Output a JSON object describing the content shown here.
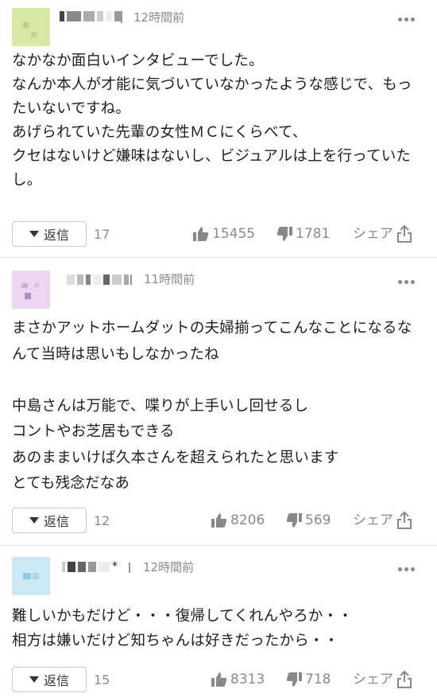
{
  "comments": [
    {
      "username": "",
      "time": "12時間前",
      "text": "なかなか面白いインタビューでした。\nなんか本人が才能に気づいていなかったような感じで、もったいないですね。\nあげられていた先輩の女性ＭＣにくらべて、\nクセはないけど嫌味はないし、ビジュアルは上を行っていたし。",
      "reply_label": "返信",
      "reply_count": "17",
      "likes": "15455",
      "dislikes": "1781",
      "share_label": "シェア",
      "avatar_color": "#d7e8a8"
    },
    {
      "username": "",
      "time": "11時間前",
      "text": "まさかアットホームダットの夫婦揃ってこんなことになるなんて当時は思いもしなかったね\n\n中島さんは万能で、喋りが上手いし回せるし\nコントやお芝居もできる\nあのままいけば久本さんを超えられたと思います\nとても残念だなあ",
      "reply_label": "返信",
      "reply_count": "12",
      "likes": "8206",
      "dislikes": "569",
      "share_label": "シェア",
      "avatar_color": "#ead7f0"
    },
    {
      "username": "",
      "time": "12時間前",
      "text": "難しいかもだけど・・・復帰してくれんやろか・・\n相方は嫌いだけど知ちゃんは好きだったから・・",
      "reply_label": "返信",
      "reply_count": "15",
      "likes": "8313",
      "dislikes": "718",
      "share_label": "シェア",
      "avatar_color": "#cfe9f5"
    }
  ],
  "icons": {
    "menu": "more-dots-icon",
    "reply": "caret-down-icon",
    "like": "thumbs-up-icon",
    "dislike": "thumbs-down-icon",
    "share": "share-icon"
  }
}
